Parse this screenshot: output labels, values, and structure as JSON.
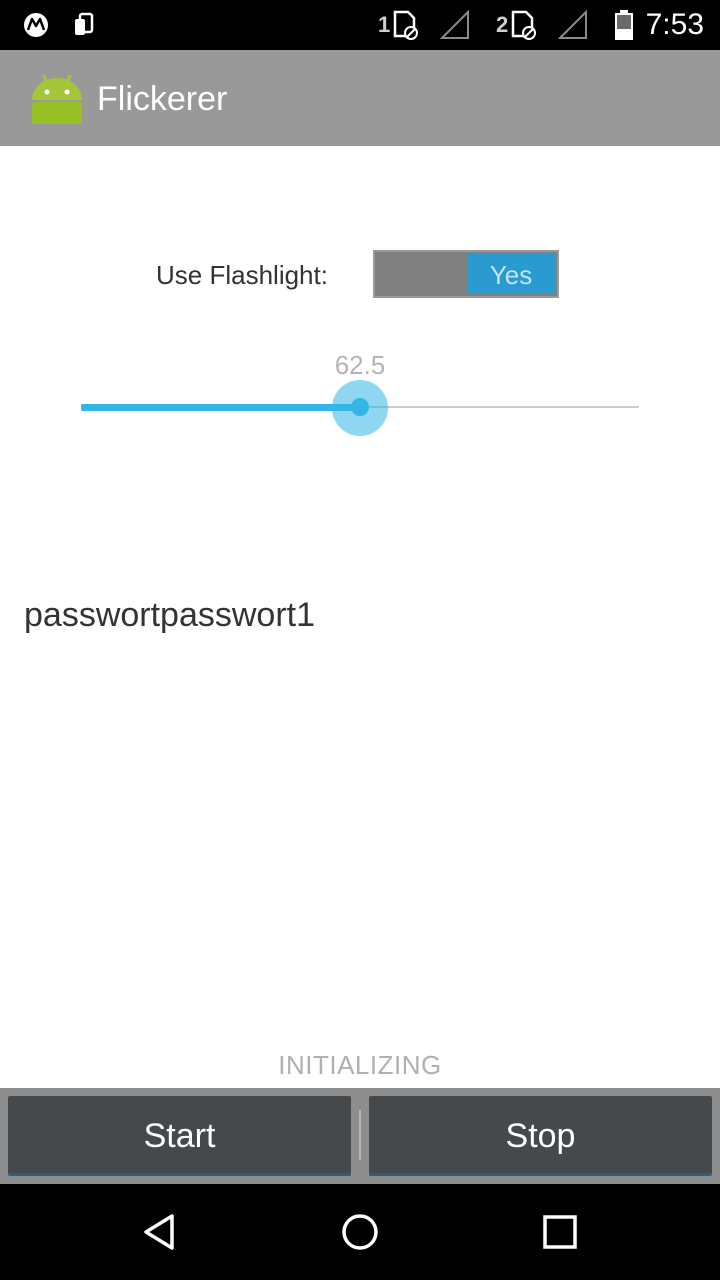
{
  "status_bar": {
    "time": "7:53",
    "sim1_label": "1",
    "sim2_label": "2",
    "icons": [
      "motorola-icon",
      "device-icon",
      "sim-icon",
      "signal-icon",
      "sim-icon",
      "signal-icon",
      "battery-icon"
    ]
  },
  "action_bar": {
    "title": "Flickerer",
    "logo_icon": "android-robot-icon",
    "color": "#999999"
  },
  "flashlight": {
    "label": "Use Flashlight:",
    "toggle_value": "Yes",
    "toggle_on": true,
    "accent": "#2a9bd1"
  },
  "seekbar": {
    "value_text": "62.5",
    "progress_fraction": 0.5,
    "accent": "#33b5e5"
  },
  "password_text": "passwortpasswort1",
  "status_text": "INITIALIZING",
  "buttons": {
    "start_label": "Start",
    "stop_label": "Stop"
  },
  "nav_bar": {
    "icons": [
      "back-icon",
      "home-icon",
      "recents-icon"
    ]
  }
}
